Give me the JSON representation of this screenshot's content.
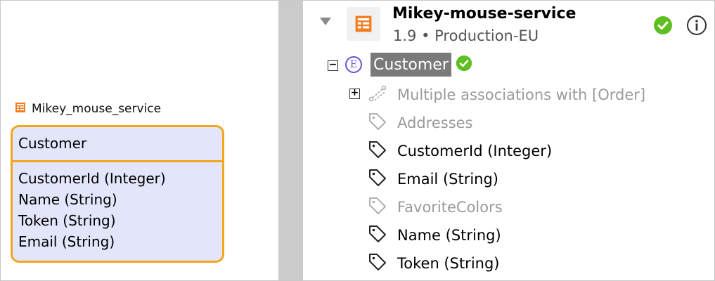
{
  "diagram": {
    "service_label": "Mikey_mouse_service",
    "entity": {
      "name": "Customer",
      "attributes": [
        "CustomerId (Integer)",
        "Name (String)",
        "Token (String)",
        "Email (String)"
      ]
    },
    "colors": {
      "border": "#f5a51c",
      "fill": "#e3e5fb"
    }
  },
  "tree": {
    "service": {
      "name": "Mikey-mouse-service",
      "meta": "1.9 • Production-EU",
      "icon": "data-service-icon",
      "status": "check-circle-icon"
    },
    "entity": {
      "name": "Customer",
      "badge": "E",
      "status": "check-circle-icon"
    },
    "items": [
      {
        "label": "Multiple associations with [Order]",
        "icon": "association-icon",
        "state": "disabled",
        "expandable": true
      },
      {
        "label": "Addresses",
        "icon": "tag-icon",
        "state": "disabled"
      },
      {
        "label": "CustomerId (Integer)",
        "icon": "tag-icon",
        "state": "enabled"
      },
      {
        "label": "Email (String)",
        "icon": "tag-icon",
        "state": "enabled"
      },
      {
        "label": "FavoriteColors",
        "icon": "tag-icon",
        "state": "disabled"
      },
      {
        "label": "Name (String)",
        "icon": "tag-icon",
        "state": "enabled"
      },
      {
        "label": "Token (String)",
        "icon": "tag-icon",
        "state": "enabled"
      }
    ]
  },
  "colors": {
    "accent_green": "#5fbf22",
    "selection": "#7a7a7a",
    "muted_text": "#9a9a9a"
  }
}
